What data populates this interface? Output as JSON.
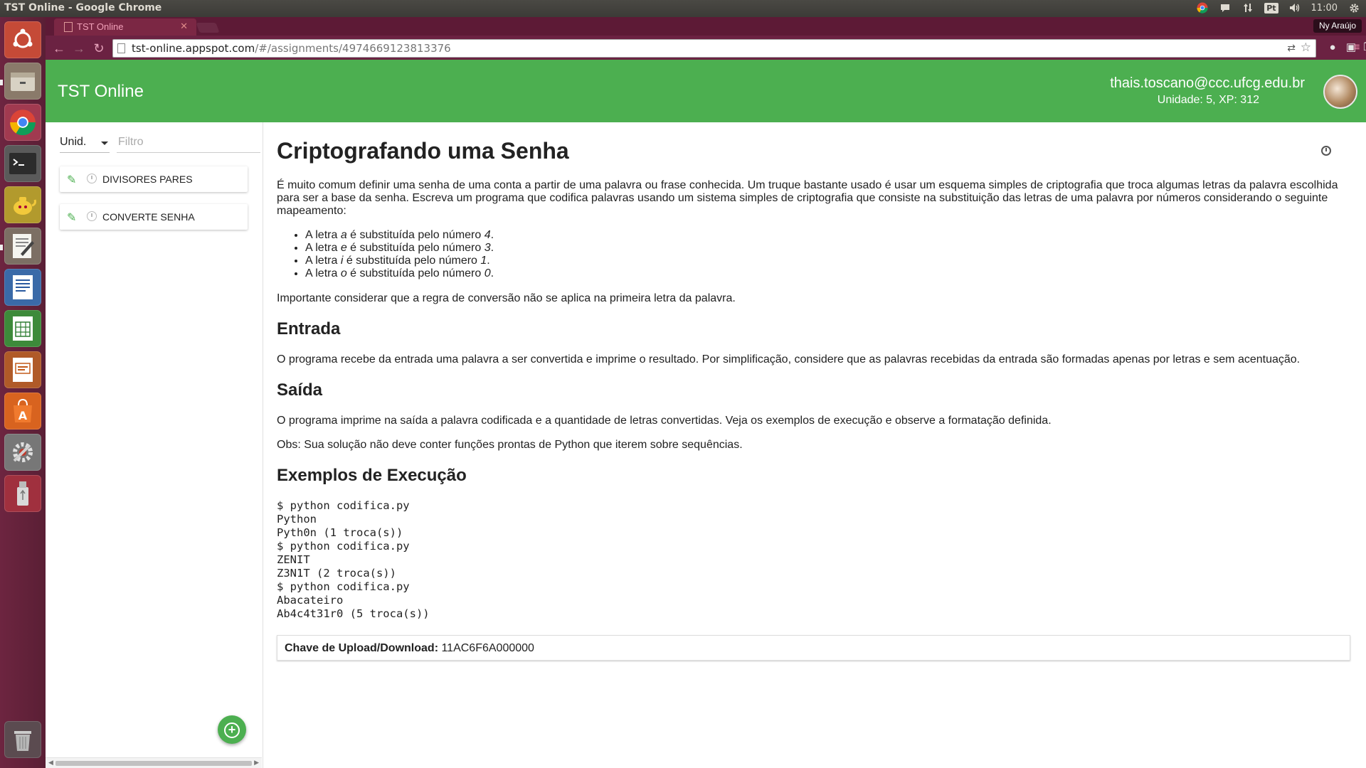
{
  "os_panel": {
    "window_title": "TST Online - Google Chrome",
    "keyboard_layout": "Pt",
    "clock": "11:00"
  },
  "browser": {
    "tab_title": "TST Online",
    "user_name": "Ny Araújo",
    "url_host": "tst-online.appspot.com",
    "url_path": "/#/assignments/4974669123813376"
  },
  "header": {
    "app_title": "TST Online",
    "email": "thais.toscano@ccc.ufcg.edu.br",
    "stats": "Unidade: 5, XP: 312"
  },
  "sidebar": {
    "unit_label": "Unid.",
    "filter_placeholder": "Filtro",
    "assignments": [
      {
        "name": "DIVISORES PARES"
      },
      {
        "name": "CONVERTE SENHA"
      }
    ]
  },
  "assignment": {
    "title": "Criptografando uma Senha",
    "intro": "É muito comum definir uma senha de uma conta a partir de uma palavra ou frase conhecida. Um truque bastante usado é usar um esquema simples de criptografia que troca algumas letras da palavra escolhida para ser a base da senha. Escreva um programa que codifica palavras usando um sistema simples de criptografia que consiste na substituição das letras de uma palavra por números considerando o seguinte mapeamento:",
    "mapping": [
      {
        "prefix": "A letra ",
        "letter": "a",
        "middle": " é substituída pelo número ",
        "number": "4",
        "suffix": "."
      },
      {
        "prefix": "A letra ",
        "letter": "e",
        "middle": " é substituída pelo número ",
        "number": "3",
        "suffix": "."
      },
      {
        "prefix": "A letra ",
        "letter": "i",
        "middle": " é substituída pelo número ",
        "number": "1",
        "suffix": "."
      },
      {
        "prefix": "A letra ",
        "letter": "o",
        "middle": " é substituída pelo número ",
        "number": "0",
        "suffix": "."
      }
    ],
    "note": "Importante considerar que a regra de conversão não se aplica na primeira letra da palavra.",
    "input_heading": "Entrada",
    "input_text": "O programa recebe da entrada uma palavra a ser convertida e imprime o resultado. Por simplificação, considere que as palavras recebidas da entrada são formadas apenas por letras e sem acentuação.",
    "output_heading": "Saída",
    "output_text": "O programa imprime na saída a palavra codificada e a quantidade de letras convertidas. Veja os exemplos de execução e observe a formatação definida.",
    "obs_text": "Obs: Sua solução não deve conter funções prontas de Python que iterem sobre sequências.",
    "examples_heading": "Exemplos de Execução",
    "examples": [
      "$ python codifica.py",
      "Python",
      "Pyth0n (1 troca(s))",
      "$ python codifica.py",
      "ZENIT",
      "Z3N1T (2 troca(s))",
      "$ python codifica.py",
      "Abacateiro",
      "Ab4c4t31r0 (5 troca(s))"
    ],
    "key_label": "Chave de Upload/Download:",
    "key_value": "11AC6F6A000000"
  },
  "colors": {
    "header_green": "#4caf50",
    "launcher": "#5a1f35",
    "chrome_frame": "#6b2242"
  }
}
